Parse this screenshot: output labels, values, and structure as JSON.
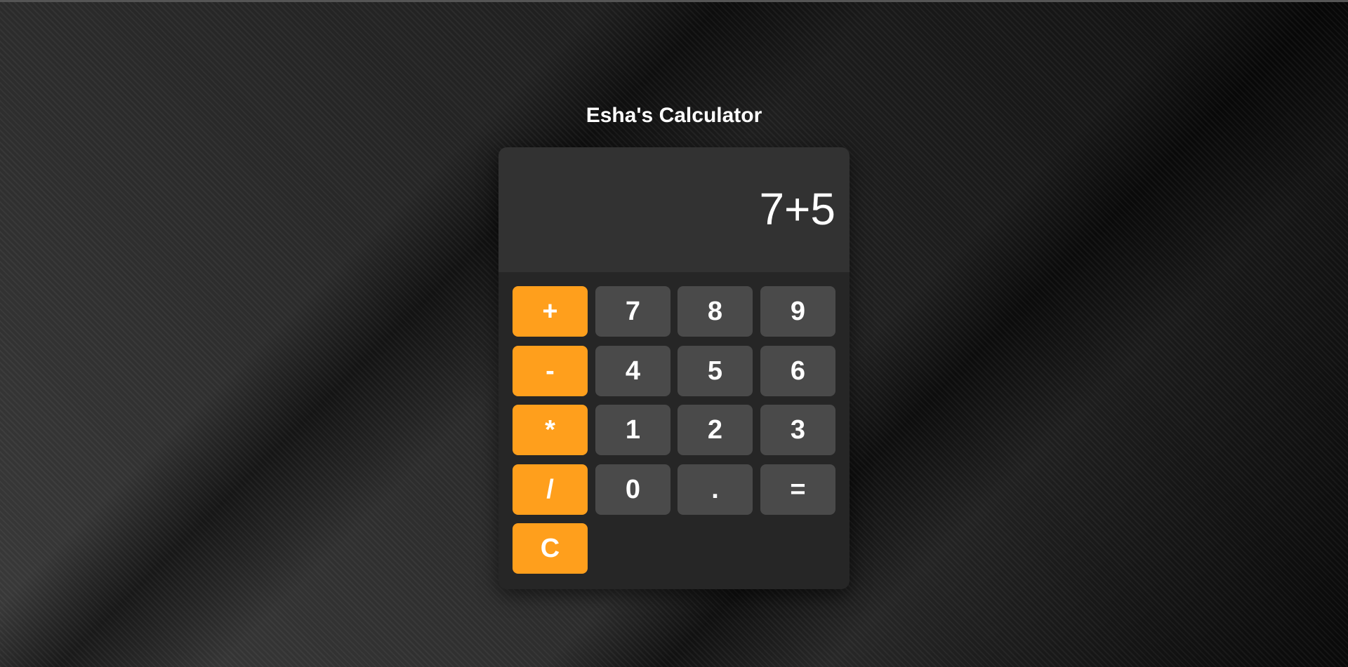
{
  "page": {
    "title": "Esha's Calculator"
  },
  "display": {
    "value": "7+5"
  },
  "keys": {
    "plus": "+",
    "minus": "-",
    "multiply": "*",
    "divide": "/",
    "clear": "C",
    "seven": "7",
    "eight": "8",
    "nine": "9",
    "four": "4",
    "five": "5",
    "six": "6",
    "one": "1",
    "two": "2",
    "three": "3",
    "zero": "0",
    "decimal": ".",
    "equals": "="
  },
  "colors": {
    "operator": "#ff9f1c",
    "number": "#4a4a4a",
    "panel": "#262626",
    "display": "#323232",
    "text": "#ffffff"
  }
}
